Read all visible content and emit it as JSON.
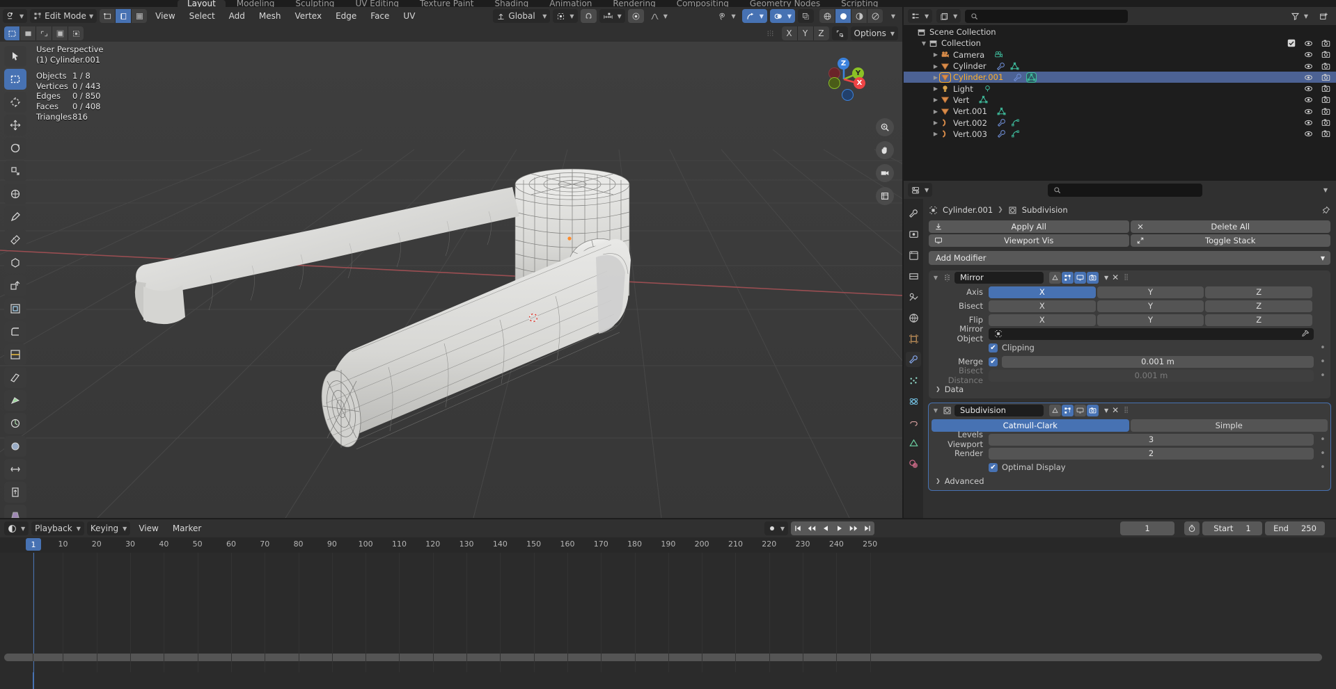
{
  "topbar": {
    "tabs": [
      "Layout",
      "Modeling",
      "Sculpting",
      "UV Editing",
      "Texture Paint",
      "Shading",
      "Animation",
      "Rendering",
      "Compositing",
      "Geometry Nodes",
      "Scripting"
    ],
    "active_tab": "Layout"
  },
  "viewport": {
    "header": {
      "editor_icon": "editor-type-icon",
      "mode": "Edit Mode",
      "select_modes": [
        "vertex-select-icon",
        "edge-select-icon",
        "face-select-icon"
      ],
      "active_select_mode": "edge-select-icon",
      "menus": [
        "View",
        "Select",
        "Add",
        "Mesh",
        "Vertex",
        "Edge",
        "Face",
        "UV"
      ],
      "transform_orientation": "Global",
      "pivot_icon": "pivot-point-icon",
      "snap_magnet_icon": "magnet-icon",
      "snap_icon": "snap-increment-icon",
      "proportional_icon": "proportional-edit-icon",
      "falloff_icon": "smooth-falloff-icon",
      "visibility_icon": "object-visibility-icon",
      "gizmo_icon": "gizmo-icon",
      "overlays_icon": "overlays-icon",
      "xray_icon": "xray-icon",
      "shading_modes": [
        "wireframe-shading-icon",
        "solid-shading-icon",
        "material-shading-icon",
        "rendered-shading-icon"
      ],
      "active_shading_mode": "solid-shading-icon"
    },
    "tool_header": {
      "select_tools": [
        "select-box-icon",
        "select-circle-icon",
        "select-lasso-icon",
        "tweak-icon",
        "select-extend-icon"
      ],
      "active_select_tool": "select-box-icon",
      "mirror_icon": "mirror-icon",
      "mirror_axes": [
        "X",
        "Y",
        "Z"
      ],
      "snap_toggle_icon": "snap-toggle-icon",
      "options_label": "Options"
    },
    "toolbar_tools": [
      "tweak-tool-icon",
      "select-box-tool-icon",
      "cursor-tool-icon",
      "move-tool-icon",
      "rotate-tool-icon",
      "scale-tool-icon",
      "transform-tool-icon",
      "annotate-tool-icon",
      "measure-tool-icon",
      "add-cube-tool-icon",
      "extrude-region-tool-icon",
      "inset-faces-tool-icon",
      "bevel-tool-icon",
      "loop-cut-tool-icon",
      "knife-tool-icon",
      "poly-build-tool-icon",
      "spin-tool-icon",
      "smooth-tool-icon",
      "edge-slide-tool-icon",
      "shrink-fatten-tool-icon",
      "shear-tool-icon",
      "rip-region-tool-icon"
    ],
    "active_toolbar_tool_index": 1,
    "overlay_stats": {
      "view_name": "User Perspective",
      "active_object": "(1) Cylinder.001",
      "rows": [
        {
          "label": "Objects",
          "value": "1 / 8"
        },
        {
          "label": "Vertices",
          "value": "0 / 443"
        },
        {
          "label": "Edges",
          "value": "0 / 850"
        },
        {
          "label": "Faces",
          "value": "0 / 408"
        },
        {
          "label": "Triangles",
          "value": "816"
        }
      ]
    },
    "gizmo_axes": [
      {
        "label": "Z",
        "color": "#3b82dd"
      },
      {
        "label": "Y",
        "color": "#8bc125"
      },
      {
        "label": "X",
        "color": "#ee4445"
      }
    ],
    "nav_buttons": [
      "zoom-icon",
      "pan-hand-icon",
      "camera-view-icon",
      "ortho-persp-icon"
    ]
  },
  "outliner": {
    "header": {
      "display_mode_icon": "outliner-display-mode-icon",
      "filter_icon": "filter-icon",
      "new_collection_icon": "new-collection-icon",
      "search_placeholder": ""
    },
    "rows": [
      {
        "indent": 0,
        "disclosure": "",
        "icon": "scene-collection-icon",
        "icon_color": "#c8c8c8",
        "name": "Scene Collection",
        "checkbox": false,
        "eye": false,
        "camera": false,
        "selected": false,
        "data_icons": []
      },
      {
        "indent": 1,
        "disclosure": "▼",
        "icon": "collection-icon",
        "icon_color": "#c8c8c8",
        "name": "Collection",
        "checkbox": true,
        "eye": true,
        "camera": true,
        "selected": false,
        "data_icons": []
      },
      {
        "indent": 2,
        "disclosure": "▶",
        "icon": "camera-object-icon",
        "icon_color": "#d88b49",
        "name": "Camera",
        "checkbox": false,
        "eye": true,
        "camera": true,
        "selected": false,
        "data_icons": [
          "camera-data-icon"
        ]
      },
      {
        "indent": 2,
        "disclosure": "▶",
        "icon": "mesh-object-icon",
        "icon_color": "#d88b49",
        "name": "Cylinder",
        "checkbox": false,
        "eye": true,
        "camera": true,
        "selected": false,
        "data_icons": [
          "modifier-icon",
          "mesh-data-icon"
        ]
      },
      {
        "indent": 2,
        "disclosure": "▶",
        "icon": "mesh-object-icon",
        "icon_color": "#d88b49",
        "name": "Cylinder.001",
        "checkbox": false,
        "eye": true,
        "camera": true,
        "selected": true,
        "data_icons": [
          "modifier-icon",
          "mesh-data-icon"
        ]
      },
      {
        "indent": 2,
        "disclosure": "▶",
        "icon": "light-object-icon",
        "icon_color": "#d8a349",
        "name": "Light",
        "checkbox": false,
        "eye": true,
        "camera": true,
        "selected": false,
        "data_icons": [
          "light-data-icon"
        ]
      },
      {
        "indent": 2,
        "disclosure": "▶",
        "icon": "mesh-object-icon",
        "icon_color": "#d88b49",
        "name": "Vert",
        "checkbox": false,
        "eye": true,
        "camera": true,
        "selected": false,
        "data_icons": [
          "mesh-data-icon"
        ]
      },
      {
        "indent": 2,
        "disclosure": "▶",
        "icon": "mesh-object-icon",
        "icon_color": "#d88b49",
        "name": "Vert.001",
        "checkbox": false,
        "eye": true,
        "camera": true,
        "selected": false,
        "data_icons": [
          "mesh-data-icon"
        ]
      },
      {
        "indent": 2,
        "disclosure": "▶",
        "icon": "curve-object-icon",
        "icon_color": "#d88b49",
        "name": "Vert.002",
        "checkbox": false,
        "eye": true,
        "camera": true,
        "selected": false,
        "data_icons": [
          "modifier-icon",
          "curve-data-icon"
        ]
      },
      {
        "indent": 2,
        "disclosure": "▶",
        "icon": "curve-object-icon",
        "icon_color": "#d88b49",
        "name": "Vert.003",
        "checkbox": false,
        "eye": true,
        "camera": true,
        "selected": false,
        "data_icons": [
          "modifier-icon",
          "curve-data-icon"
        ]
      }
    ]
  },
  "properties": {
    "header": {
      "editor_icon": "properties-editor-icon",
      "search_placeholder": ""
    },
    "tabs": [
      "tool-tab-icon",
      "render-tab-icon",
      "output-tab-icon",
      "view-layer-tab-icon",
      "scene-tab-icon",
      "world-tab-icon",
      "object-tab-icon",
      "modifier-tab-icon",
      "particles-tab-icon",
      "physics-tab-icon",
      "constraints-tab-icon",
      "data-tab-icon",
      "material-tab-icon"
    ],
    "active_tab_index": 7,
    "breadcrumb": {
      "object_icon": "object-icon",
      "object": "Cylinder.001",
      "separator": "❯",
      "modifier_icon": "subdivision-icon",
      "modifier": "Subdivision",
      "pin_icon": "pin-icon"
    },
    "stack_buttons": [
      {
        "icon": "apply-icon",
        "label": "Apply All"
      },
      {
        "icon": "delete-icon",
        "label": "Delete All"
      },
      {
        "icon": "viewport-vis-icon",
        "label": "Viewport Vis"
      },
      {
        "icon": "toggle-stack-icon",
        "label": "Toggle Stack"
      }
    ],
    "add_modifier_label": "Add Modifier",
    "modifiers": [
      {
        "expand_icon": "▼",
        "type_icon": "mirror-modifier-icon",
        "name": "Mirror",
        "selected": false,
        "display_toggles": [
          {
            "icon": "on-cage-icon",
            "on": false
          },
          {
            "icon": "edit-mode-icon",
            "on": true
          },
          {
            "icon": "realtime-icon",
            "on": true
          },
          {
            "icon": "render-icon",
            "on": true
          }
        ],
        "dropdown_icon": "chevron-down-icon",
        "close_icon": "close-icon",
        "grip_icon": "drag-grip-icon",
        "rows": [
          {
            "kind": "axis",
            "label": "Axis",
            "options": [
              "X",
              "Y",
              "Z"
            ],
            "active": [
              "X"
            ]
          },
          {
            "kind": "axis",
            "label": "Bisect",
            "options": [
              "X",
              "Y",
              "Z"
            ],
            "active": []
          },
          {
            "kind": "axis",
            "label": "Flip",
            "options": [
              "X",
              "Y",
              "Z"
            ],
            "active": []
          },
          {
            "kind": "object",
            "label": "Mirror Object",
            "value": "",
            "icon": "object-field-icon",
            "eyedropper": "eyedropper-icon"
          },
          {
            "kind": "check",
            "label": "Clipping",
            "checked": true
          },
          {
            "kind": "check_value",
            "label": "Merge",
            "checked": true,
            "value": "0.001 m"
          },
          {
            "kind": "value_dim",
            "label": "Bisect Distance",
            "value": "0.001 m"
          },
          {
            "kind": "subpanel",
            "label": "Data",
            "arrow": "❯"
          }
        ]
      },
      {
        "expand_icon": "▼",
        "type_icon": "subdivision-modifier-icon",
        "name": "Subdivision",
        "selected": true,
        "display_toggles": [
          {
            "icon": "on-cage-icon",
            "on": false
          },
          {
            "icon": "edit-mode-icon",
            "on": true
          },
          {
            "icon": "realtime-icon",
            "on": false
          },
          {
            "icon": "render-icon",
            "on": true
          }
        ],
        "dropdown_icon": "chevron-down-icon",
        "close_icon": "close-icon",
        "grip_icon": "drag-grip-icon",
        "algorithm_options": [
          "Catmull-Clark",
          "Simple"
        ],
        "algorithm_active": "Catmull-Clark",
        "rows": [
          {
            "kind": "value",
            "label": "Levels Viewport",
            "value": "3"
          },
          {
            "kind": "value",
            "label": "Render",
            "value": "2"
          },
          {
            "kind": "check",
            "label": "Optimal Display",
            "checked": true
          },
          {
            "kind": "subpanel",
            "label": "Advanced",
            "arrow": "❯"
          }
        ]
      }
    ]
  },
  "timeline": {
    "editor_icon": "timeline-editor-icon",
    "menus": [
      "Playback",
      "Keying",
      "View",
      "Marker"
    ],
    "auto_key_icon": "record-icon",
    "transport": [
      "jump-start-icon",
      "prev-keyframe-icon",
      "play-reverse-icon",
      "play-icon",
      "next-keyframe-icon",
      "jump-end-icon"
    ],
    "current_frame": "1",
    "timer_icon": "stopwatch-icon",
    "start_label": "Start",
    "start_value": "1",
    "end_label": "End",
    "end_value": "250",
    "ruler_ticks": [
      "1",
      "10",
      "20",
      "30",
      "40",
      "50",
      "60",
      "70",
      "80",
      "90",
      "100",
      "110",
      "120",
      "130",
      "140",
      "150",
      "160",
      "170",
      "180",
      "190",
      "200",
      "210",
      "220",
      "230",
      "240",
      "250"
    ],
    "playhead_frame": "1"
  },
  "colors": {
    "accent_blue": "#4772b3",
    "selected_orange": "#ffaf29",
    "header_bg": "#303030",
    "panel_bg": "#3b3b3b",
    "editor_bg": "#1d1d1d"
  }
}
